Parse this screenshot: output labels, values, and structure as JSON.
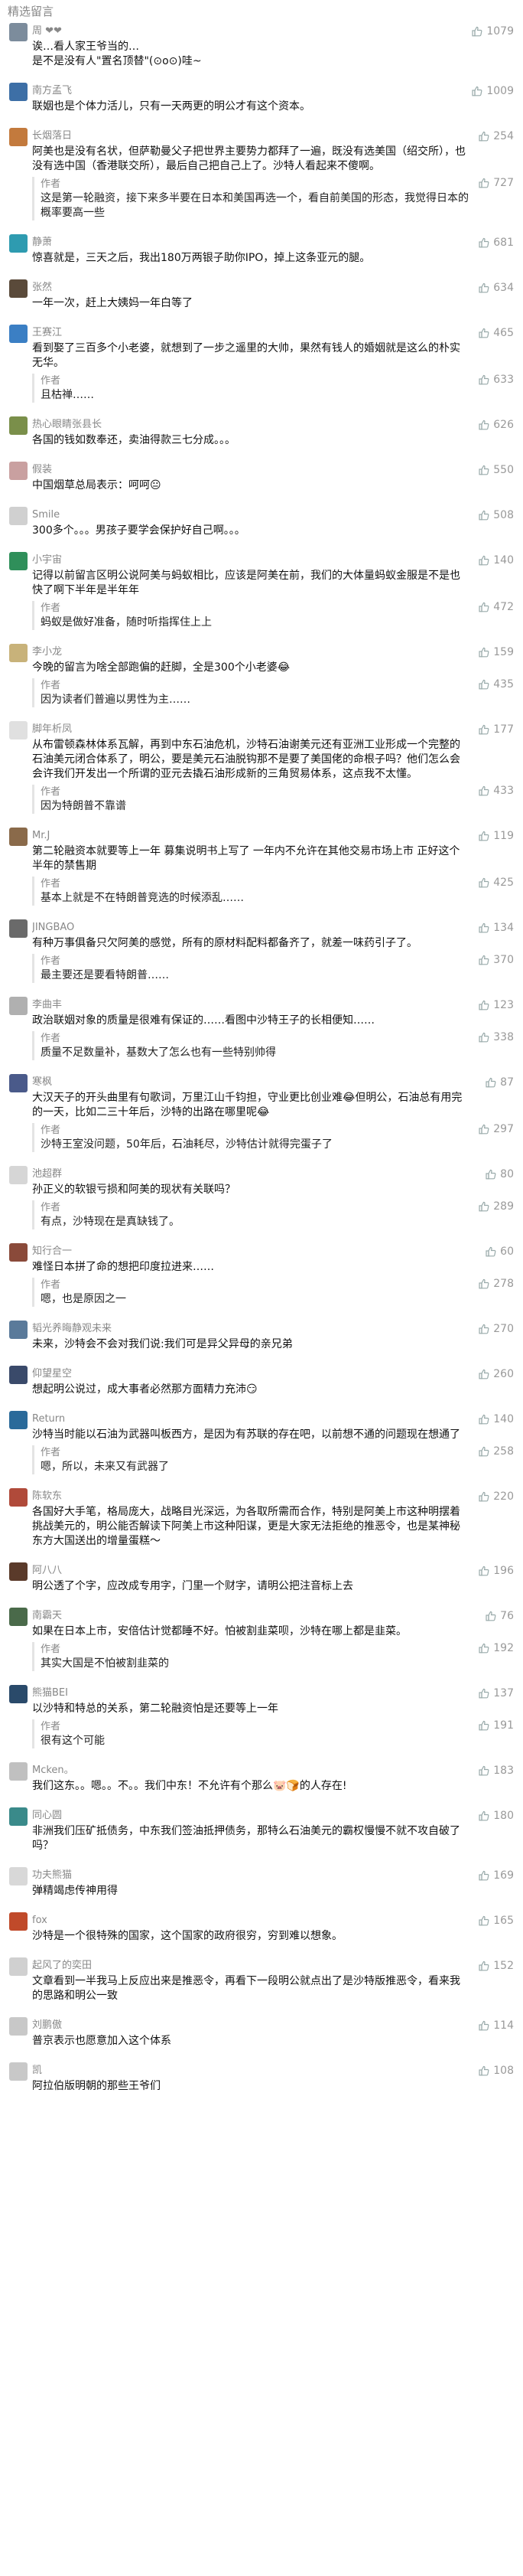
{
  "header": {
    "title": "精选留言"
  },
  "author_label": "作者",
  "comments": [
    {
      "name": "周 ❤❤",
      "likes": "1079",
      "avatar_color": "#7c8c9c",
      "content": "诶…看人家王爷当的…\n是不是没有人\"置名顶替\"(⊙o⊙)哇~"
    },
    {
      "name": "南方孟飞",
      "likes": "1009",
      "avatar_color": "#3d6fa6",
      "content": "联姻也是个体力活儿，只有一天两更的明公才有这个资本。"
    },
    {
      "name": "长烟落日",
      "likes": "254",
      "avatar_color": "#c37a3d",
      "content": "阿美也是没有名状，但萨勒曼父子把世界主要势力都拜了一遍，既没有选美国（绍交所），也没有选中国（香港联交所），最后自己把自己上了。沙特人看起来不傻啊。",
      "reply": {
        "text": "这是第一轮融资，接下来多半要在日本和美国再选一个，看自前美国的形态，我觉得日本的概率要高一些",
        "likes": "727"
      }
    },
    {
      "name": "静萧",
      "likes": "681",
      "avatar_color": "#2e9bb0",
      "content": "惊喜就是，三天之后，我出180万两银子助你IPO，掉上这条亚元的腿。"
    },
    {
      "name": "张然",
      "likes": "634",
      "avatar_color": "#5a4a3a",
      "content": "一年一次，赶上大姨妈一年白等了"
    },
    {
      "name": "王赛江",
      "likes": "465",
      "avatar_color": "#3b7fc4",
      "content": "看到娶了三百多个小老婆，就想到了一步之遥里的大帅，果然有钱人的婚姻就是这么的朴实无华。",
      "reply": {
        "text": "且枯禅……",
        "likes": "633"
      }
    },
    {
      "name": "热心眼睛张县长",
      "likes": "626",
      "avatar_color": "#7a8f4a",
      "content": "各国的钱如数奉还，卖油得款三七分成。。。"
    },
    {
      "name": "假装",
      "likes": "550",
      "avatar_color": "#c9a0a0",
      "content": "中国烟草总局表示：呵呵😐"
    },
    {
      "name": "Smile",
      "likes": "508",
      "avatar_color": "#d0d0d0",
      "content": "300多个。。。男孩子要学会保护好自己啊。。。"
    },
    {
      "name": "小宇宙",
      "likes": "140",
      "avatar_color": "#2f8f5a",
      "content": "记得以前留言区明公说阿美与蚂蚁相比，应该是阿美在前，我们的大体量蚂蚁金服是不是也快了啊下半年是半年年",
      "reply": {
        "text": "蚂蚁是做好准备，随时听指挥住上上",
        "likes": "472"
      }
    },
    {
      "name": "李小龙",
      "likes": "159",
      "avatar_color": "#c8b27a",
      "content": "今晚的留言为啥全部跑偏的赶脚，全是300个小老婆😂",
      "reply": {
        "text": "因为读者们普遍以男性为主……",
        "likes": "435"
      }
    },
    {
      "name": "脚年析凤",
      "likes": "177",
      "avatar_color": "#e0e0e0",
      "content": "从布雷顿森林体系瓦解，再到中东石油危机，沙特石油谢美元还有亚洲工业形成一个完整的石油美元闭合体系了，明公，要是美元石油脱钩那不是要了美国佬的命根子吗？他们怎么会会许我们开发出一个所谓的亚元去撬石油形成新的三角贸易体系，这点我不太懂。",
      "reply": {
        "text": "因为特朗普不靠谱",
        "likes": "433"
      }
    },
    {
      "name": "Mr.J",
      "likes": "119",
      "avatar_color": "#8a6a4a",
      "content": "第二轮融资本就要等上一年 募集说明书上写了 一年内不允许在其他交易市场上市 正好这个半年的禁售期",
      "reply": {
        "text": "基本上就是不在特朗普竞选的时候添乱……",
        "likes": "425"
      }
    },
    {
      "name": "JINGBAO",
      "likes": "134",
      "avatar_color": "#6a6a6a",
      "content": "有种万事俱备只欠阿美的感觉，所有的原材料配料都备齐了，就差一味药引子了。",
      "reply": {
        "text": "最主要还是要看特朗普……",
        "likes": "370"
      }
    },
    {
      "name": "李曲丰",
      "likes": "123",
      "avatar_color": "#b0b0b0",
      "content": "政治联姻对象的质量是很难有保证的……看图中沙特王子的长相便知……",
      "reply": {
        "text": "质量不足数量补，基数大了怎么也有一些特别帅得",
        "likes": "338"
      }
    },
    {
      "name": "寒枫",
      "likes": "87",
      "avatar_color": "#4a5a8a",
      "content": "大汉天子的开头曲里有句歌词，万里江山千钧担，守业更比创业难😂但明公，石油总有用完的一天，比如二三十年后，沙特的出路在哪里呢😂",
      "reply": {
        "text": "沙特王室没问题，50年后，石油耗尽，沙特估计就得完蛋子了",
        "likes": "297"
      }
    },
    {
      "name": "池超群",
      "likes": "80",
      "avatar_color": "#d6d6d6",
      "content": "孙正义的软银亏损和阿美的现状有关联吗？",
      "reply": {
        "text": "有点，沙特现在是真缺钱了。",
        "likes": "289"
      }
    },
    {
      "name": "知行合一",
      "likes": "60",
      "avatar_color": "#8a4a3a",
      "content": "难怪日本拼了命的想把印度拉进来……",
      "reply": {
        "text": "嗯，也是原因之一",
        "likes": "278"
      }
    },
    {
      "name": "韬光养晦静观未来",
      "likes": "270",
      "avatar_color": "#5a7a9a",
      "content": "未来，沙特会不会对我们说:我们可是异父异母的亲兄弟"
    },
    {
      "name": "仰望星空",
      "likes": "260",
      "avatar_color": "#3a4a6a",
      "content": "想起明公说过，成大事者必然那方面精力充沛😏"
    },
    {
      "name": "Return",
      "likes": "140",
      "avatar_color": "#2a6a9a",
      "content": "沙特当时能以石油为武器叫板西方，是因为有苏联的存在吧，以前想不通的问题现在想通了",
      "reply": {
        "text": "嗯，所以，未来又有武器了",
        "likes": "258"
      }
    },
    {
      "name": "陈软东",
      "likes": "220",
      "avatar_color": "#b04a3a",
      "content": "各国好大手笔，格局庞大，战略目光深远，为各取所需而合作，特别是阿美上市这种明摆着挑战美元的，明公能否解读下阿美上市这种阳谋，更是大家无法拒绝的推恶令，也是某神秘东方大国送出的增量蛋糕～",
      "reply": null
    },
    {
      "name": "阿八八",
      "likes": "196",
      "avatar_color": "#5a3a2a",
      "content": "明公透了个字，应改成专用字，门里一个财字，请明公把注音标上去"
    },
    {
      "name": "南霸天",
      "likes": "76",
      "avatar_color": "#4a6a4a",
      "content": "如果在日本上市，安倍估计觉都睡不好。怕被割韭菜呗，沙特在哪上都是韭菜。",
      "reply": {
        "text": "其实大国是不怕被割韭菜的",
        "likes": "192"
      }
    },
    {
      "name": "熊猫BEI",
      "likes": "137",
      "avatar_color": "#2a4a6a",
      "content": "以沙特和特总的关系，第二轮融资怕是还要等上一年",
      "reply": {
        "text": "很有这个可能",
        "likes": "191"
      }
    },
    {
      "name": "Mcken。",
      "likes": "183",
      "avatar_color": "#c0c0c0",
      "content": "我们这东。。嗯。。不。。我们中东！不允许有个那么🐷🍞的人存在!"
    },
    {
      "name": "同心圆",
      "likes": "180",
      "avatar_color": "#3a8a8a",
      "content": "非洲我们压矿抵债务，中东我们签油抵押债务，那特么石油美元的霸权慢慢不就不攻自破了吗？"
    },
    {
      "name": "功夫熊猫",
      "likes": "169",
      "avatar_color": "#d8d8d8",
      "content": "弹精竭虑传神用得"
    },
    {
      "name": "fox",
      "likes": "165",
      "avatar_color": "#c04a2a",
      "content": "沙特是一个很特殊的国家，这个国家的政府很穷，穷到难以想象。"
    },
    {
      "name": "起风了的奕田",
      "likes": "152",
      "avatar_color": "#d0d0d0",
      "content": "文章看到一半我马上反应出来是推恶令，再看下一段明公就点出了是沙特版推恶令，看来我的思路和明公一致"
    },
    {
      "name": "刘鹏傲",
      "likes": "114",
      "avatar_color": "#c8c8c8",
      "content": "普京表示也愿意加入这个体系"
    },
    {
      "name": "凯",
      "likes": "108",
      "avatar_color": "#c8c8c8",
      "content": "阿拉伯版明朝的那些王爷们"
    }
  ]
}
